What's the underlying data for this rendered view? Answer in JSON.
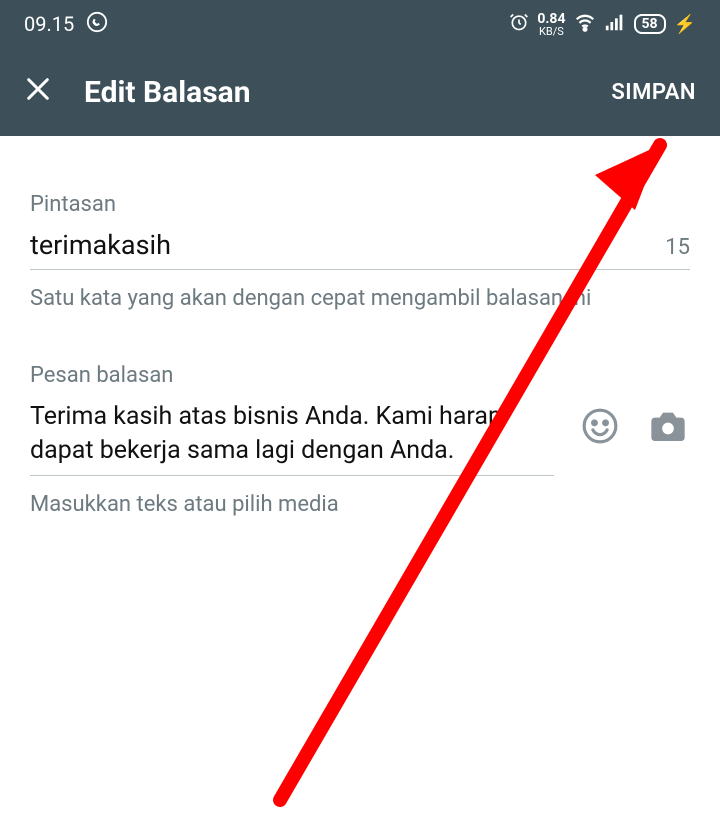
{
  "status": {
    "time": "09.15",
    "whatsapp_icon": "whatsapp",
    "alarm_icon": "alarm",
    "data_value": "0.84",
    "data_unit": "KB/S",
    "wifi_icon": "wifi",
    "signal_icon": "signal",
    "battery_value": "58",
    "charging": "⚡"
  },
  "header": {
    "title": "Edit Balasan",
    "save_label": "SIMPAN"
  },
  "shortcut": {
    "label": "Pintasan",
    "value": "terimakasih",
    "remaining": "15",
    "helper": "Satu kata yang akan dengan cepat mengambil balasan ini"
  },
  "message": {
    "label": "Pesan balasan",
    "value": "Terima kasih atas bisnis Anda. Kami harap dapat bekerja sama lagi dengan Anda.",
    "helper": "Masukkan teks atau pilih media"
  },
  "annotation": {
    "arrow_color": "#ff0000"
  }
}
